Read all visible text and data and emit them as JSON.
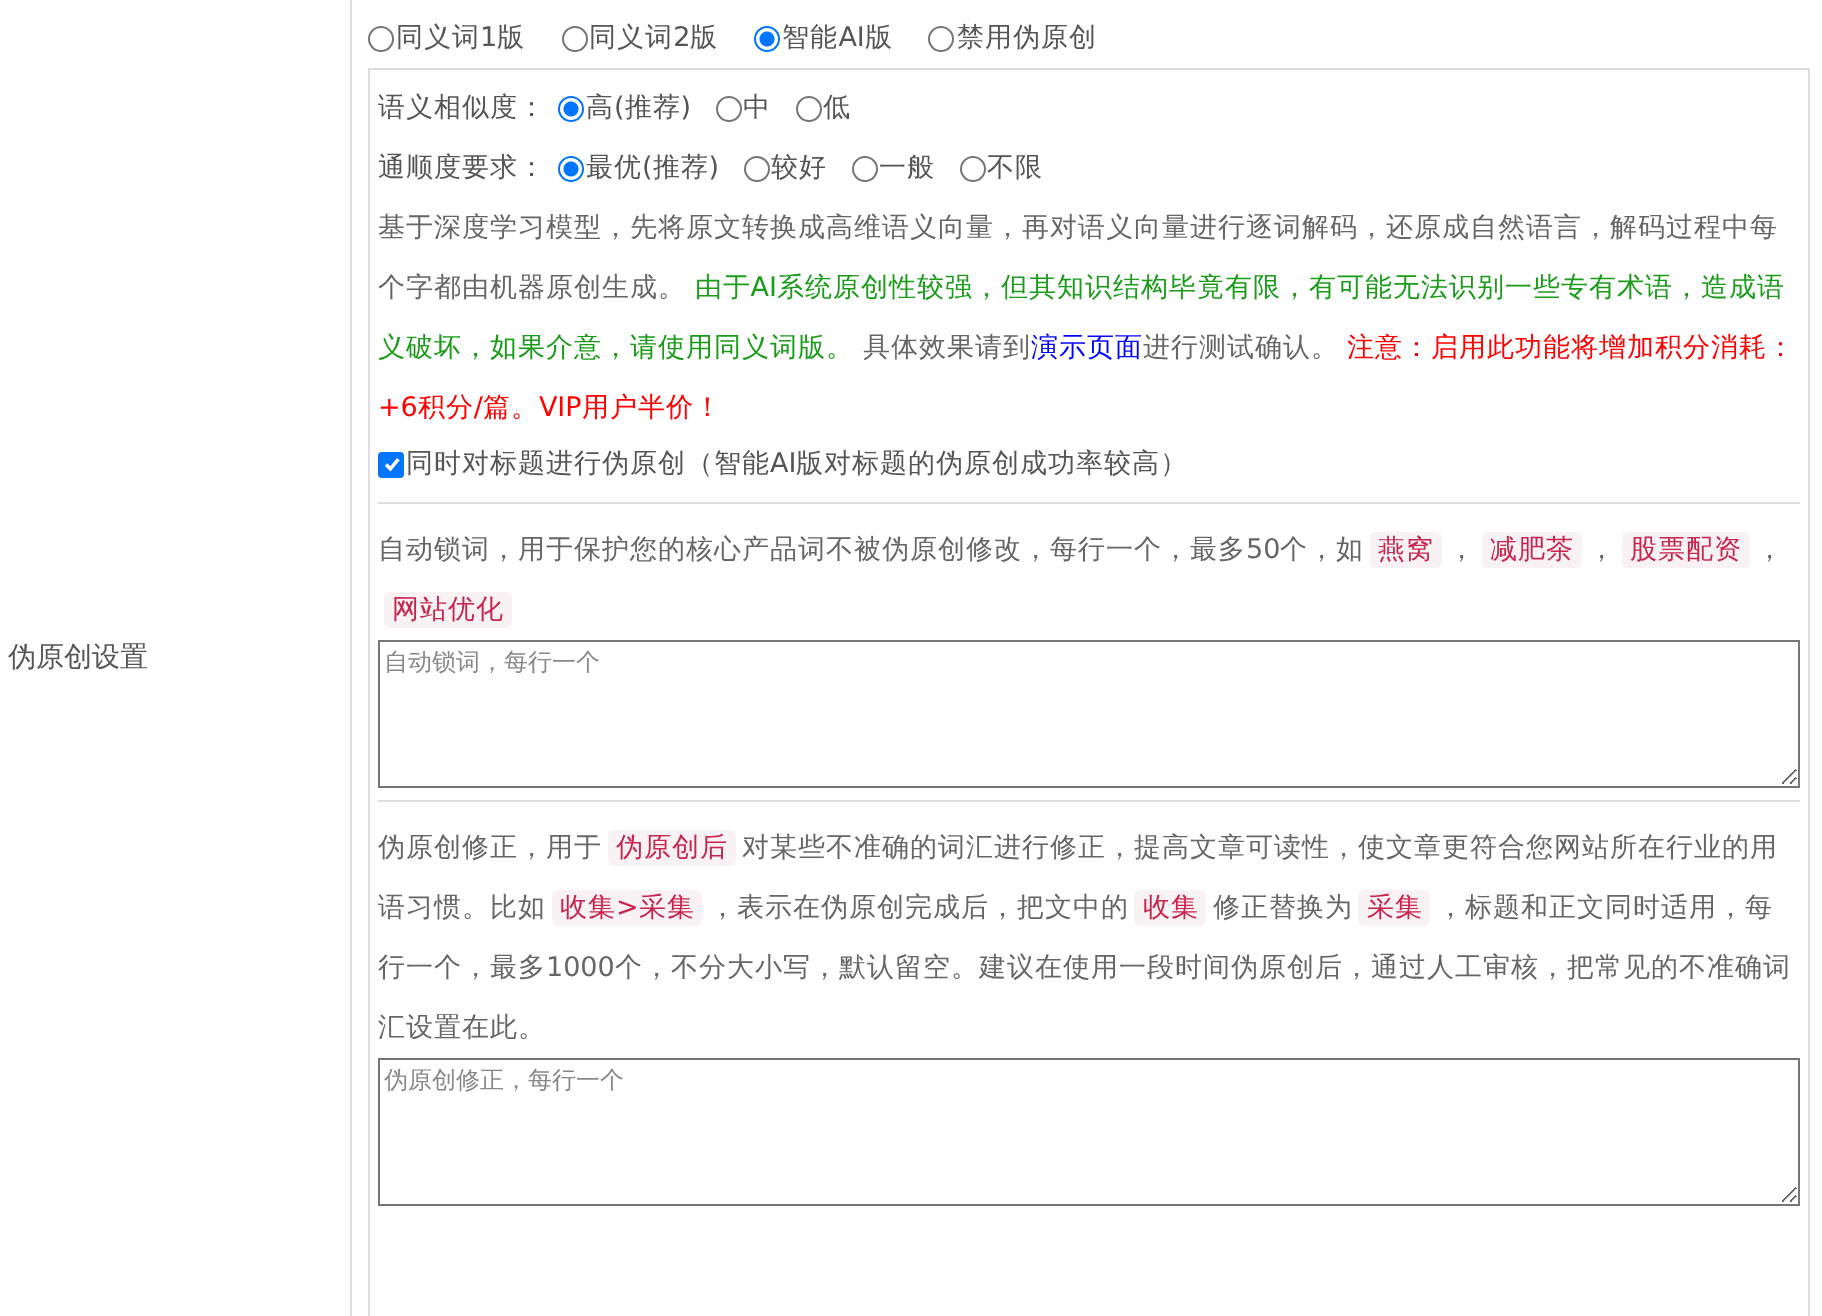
{
  "section_label": "伪原创设置",
  "modes": [
    {
      "label": "同义词1版",
      "selected": false
    },
    {
      "label": "同义词2版",
      "selected": false
    },
    {
      "label": "智能AI版",
      "selected": true
    },
    {
      "label": "禁用伪原创",
      "selected": false
    }
  ],
  "similarity": {
    "label": "语义相似度：",
    "options": [
      {
        "label": "高(推荐)",
        "selected": true
      },
      {
        "label": "中",
        "selected": false
      },
      {
        "label": "低",
        "selected": false
      }
    ]
  },
  "fluency": {
    "label": "通顺度要求：",
    "options": [
      {
        "label": "最优(推荐)",
        "selected": true
      },
      {
        "label": "较好",
        "selected": false
      },
      {
        "label": "一般",
        "selected": false
      },
      {
        "label": "不限",
        "selected": false
      }
    ]
  },
  "description": [
    {
      "kind": "plain",
      "text": "基于深度学习模型，先将原文转换成高维语义向量，再对语义向量进行逐词解码，还原成自然语言，解码过程中每个字都由机器原创生成。 "
    },
    {
      "kind": "green",
      "text": "由于AI系统原创性较强，但其知识结构毕竟有限，有可能无法识别一些专有术语，造成语义破坏，如果介意，请使用同义词版。"
    },
    {
      "kind": "plain",
      "text": " 具体效果请到"
    },
    {
      "kind": "link",
      "text": "演示页面"
    },
    {
      "kind": "plain",
      "text": "进行测试确认。 "
    },
    {
      "kind": "red",
      "text": "注意：启用此功能将增加积分消耗：+6积分/篇。VIP用户半价！"
    }
  ],
  "title_option": {
    "label": "同时对标题进行伪原创（智能AI版对标题的伪原创成功率较高）",
    "checked": true
  },
  "lock_words": {
    "description": [
      {
        "kind": "plain",
        "text": "自动锁词，用于保护您的核心产品词不被伪原创修改，每行一个，最多50个，如"
      },
      {
        "kind": "code",
        "text": "燕窝"
      },
      {
        "kind": "plain",
        "text": "，"
      },
      {
        "kind": "code",
        "text": "减肥茶"
      },
      {
        "kind": "plain",
        "text": "，"
      },
      {
        "kind": "code",
        "text": "股票配资"
      },
      {
        "kind": "plain",
        "text": "，"
      },
      {
        "kind": "code",
        "text": "网站优化"
      }
    ],
    "placeholder": "自动锁词，每行一个"
  },
  "corrections": {
    "description": [
      {
        "kind": "plain",
        "text": "伪原创修正，用于"
      },
      {
        "kind": "code",
        "text": "伪原创后"
      },
      {
        "kind": "plain",
        "text": "对某些不准确的词汇进行修正，提高文章可读性，使文章更符合您网站所在行业的用语习惯。比如"
      },
      {
        "kind": "code",
        "text": "收集>采集"
      },
      {
        "kind": "plain",
        "text": "，表示在伪原创完成后，把文中的"
      },
      {
        "kind": "code",
        "text": "收集"
      },
      {
        "kind": "plain",
        "text": "修正替换为"
      },
      {
        "kind": "code",
        "text": "采集"
      },
      {
        "kind": "plain",
        "text": "，标题和正文同时适用，每行一个，最多1000个，不分大小写，默认留空。建议在使用一段时间伪原创后，通过人工审核，把常见的不准确词汇设置在此。"
      }
    ],
    "placeholder": "伪原创修正，每行一个"
  }
}
